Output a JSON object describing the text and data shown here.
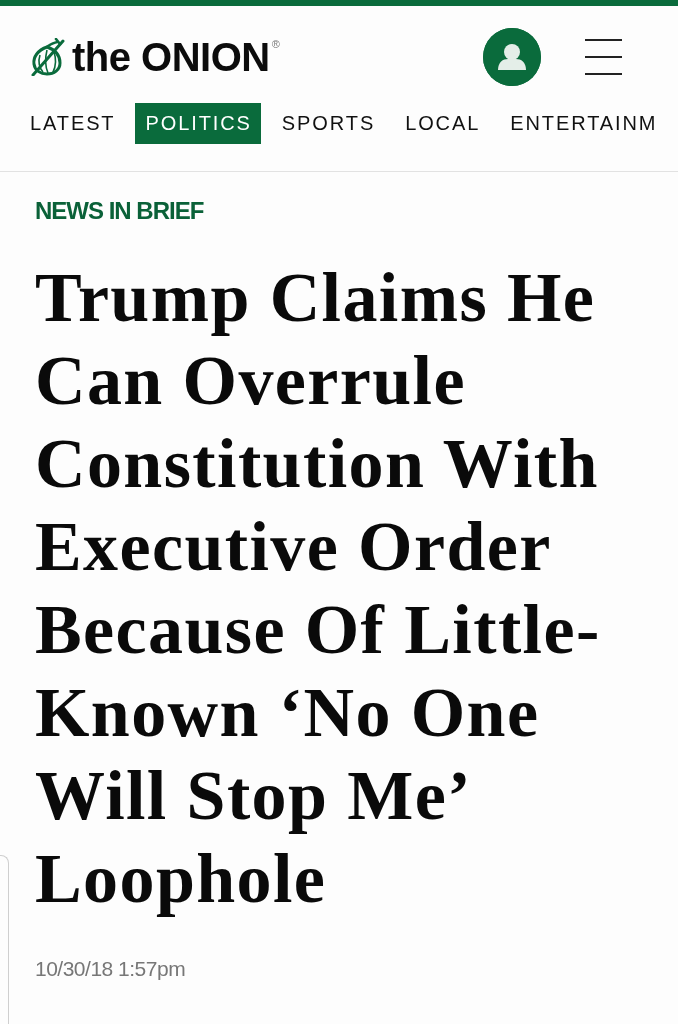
{
  "header": {
    "logo": {
      "text": "the ONION",
      "mark": "®"
    }
  },
  "nav": [
    {
      "label": "LATEST",
      "selected": false
    },
    {
      "label": "POLITICS",
      "selected": true
    },
    {
      "label": "SPORTS",
      "selected": false
    },
    {
      "label": "LOCAL",
      "selected": false
    },
    {
      "label": "ENTERTAINM",
      "selected": false
    }
  ],
  "article": {
    "category": "NEWS IN BRIEF",
    "headline": "Trump Claims He Can Overrule Constitution With Executive Order Because Of Little-Known ‘No One Will Stop Me’ Loophole",
    "date": "10/30/18 1:57pm"
  }
}
